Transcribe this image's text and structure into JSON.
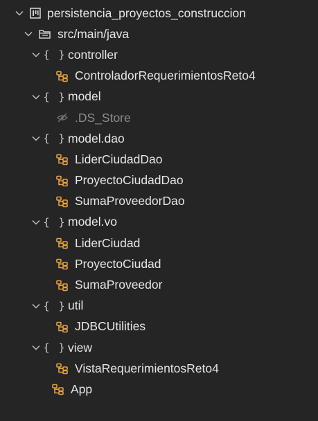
{
  "colors": {
    "background": "#252526",
    "text": "#e6e6e6",
    "dim_text": "#8c8c8c",
    "java_icon": "#e6a23c",
    "chevron": "#c5c5c5"
  },
  "tree": {
    "project": {
      "label": "persistencia_proyectos_construccion",
      "icon": "project-board-icon"
    },
    "source_folder": {
      "label": "src/main/java",
      "icon": "source-folder-icon"
    },
    "packages": {
      "controller": {
        "label": "controller",
        "icon": "package-braces-icon",
        "files": [
          "ControladorRequerimientosReto4"
        ]
      },
      "model": {
        "label": "model",
        "icon": "package-braces-icon",
        "files": [
          ".DS_Store"
        ]
      },
      "model_dao": {
        "label": "model.dao",
        "icon": "package-braces-icon",
        "files": [
          "LiderCiudadDao",
          "ProyectoCiudadDao",
          "SumaProveedorDao"
        ]
      },
      "model_vo": {
        "label": "model.vo",
        "icon": "package-braces-icon",
        "files": [
          "LiderCiudad",
          "ProyectoCiudad",
          "SumaProveedor"
        ]
      },
      "util": {
        "label": "util",
        "icon": "package-braces-icon",
        "files": [
          "JDBCUtilities"
        ]
      },
      "view": {
        "label": "view",
        "icon": "package-braces-icon",
        "files": [
          "VistaRequerimientosReto4"
        ]
      }
    },
    "root_class": {
      "label": "App",
      "icon": "java-class-icon"
    },
    "package_icon_glyph": "{ }"
  }
}
